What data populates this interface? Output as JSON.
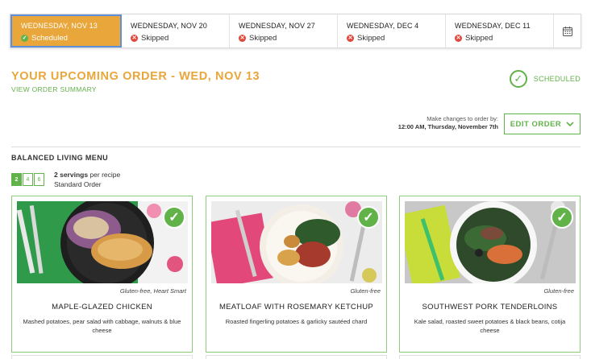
{
  "weeks": [
    {
      "date": "WEDNESDAY, NOV 13",
      "status": "Scheduled",
      "state": "scheduled"
    },
    {
      "date": "WEDNESDAY, NOV 20",
      "status": "Skipped",
      "state": "skipped"
    },
    {
      "date": "WEDNESDAY, NOV 27",
      "status": "Skipped",
      "state": "skipped"
    },
    {
      "date": "WEDNESDAY, DEC 4",
      "status": "Skipped",
      "state": "skipped"
    },
    {
      "date": "WEDNESDAY, DEC 11",
      "status": "Skipped",
      "state": "skipped"
    }
  ],
  "calendar_icon": "calendar-icon",
  "order": {
    "title": "YOUR UPCOMING ORDER - WED, NOV 13",
    "summary_link": "VIEW ORDER SUMMARY",
    "status": "SCHEDULED"
  },
  "changes": {
    "line1": "Make changes to order by:",
    "line2": "12:00 AM, Thursday, November 7th"
  },
  "edit_button": "EDIT ORDER",
  "menu": {
    "title": "BALANCED LIVING MENU",
    "servings_options": [
      "2",
      "4",
      "6"
    ],
    "selected_servings": "2",
    "servings_bold": "2 servings",
    "servings_rest": " per recipe",
    "order_type": "Standard Order"
  },
  "recipes": [
    {
      "tags": "Gluten-free, Heart Smart",
      "name": "MAPLE-GLAZED CHICKEN",
      "desc": "Mashed potatoes, pear salad with cabbage, walnuts & blue cheese"
    },
    {
      "tags": "Gluten-free",
      "name": "MEATLOAF WITH ROSEMARY KETCHUP",
      "desc": "Roasted fingerling potatoes & garlicky sautéed chard"
    },
    {
      "tags": "Gluten-free",
      "name": "SOUTHWEST PORK TENDERLOINS",
      "desc": "Kale salad, roasted sweet potatoes & black beans, cotija cheese"
    }
  ],
  "colors": {
    "accent_orange": "#e9a63a",
    "accent_green": "#62b24a",
    "skip_red": "#e0473a"
  }
}
